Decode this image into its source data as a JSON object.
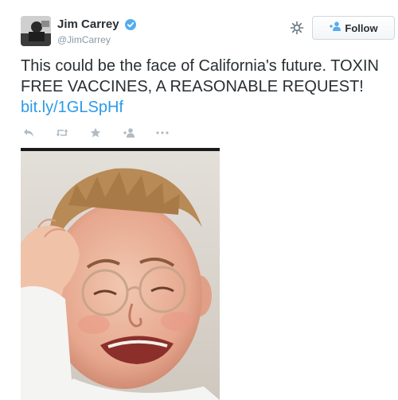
{
  "author": {
    "name": "Jim Carrey",
    "handle": "@JimCarrey",
    "verified": true
  },
  "follow": {
    "label": "Follow"
  },
  "tweet": {
    "text": "This could be the face of California's future. TOXIN FREE VACCINES, A REASONABLE REQUEST!",
    "link": "bit.ly/1GLSpHf"
  },
  "icons": {
    "settings": "gear-icon",
    "follow": "add-user-icon",
    "reply": "reply-icon",
    "retweet": "retweet-icon",
    "favorite": "star-icon",
    "follow_action": "add-user-icon",
    "more": "more-icon"
  },
  "colors": {
    "link": "#2b9ae8",
    "verified": "#55acee",
    "icon_gray": "#b1bbc3",
    "text": "#292f33"
  }
}
